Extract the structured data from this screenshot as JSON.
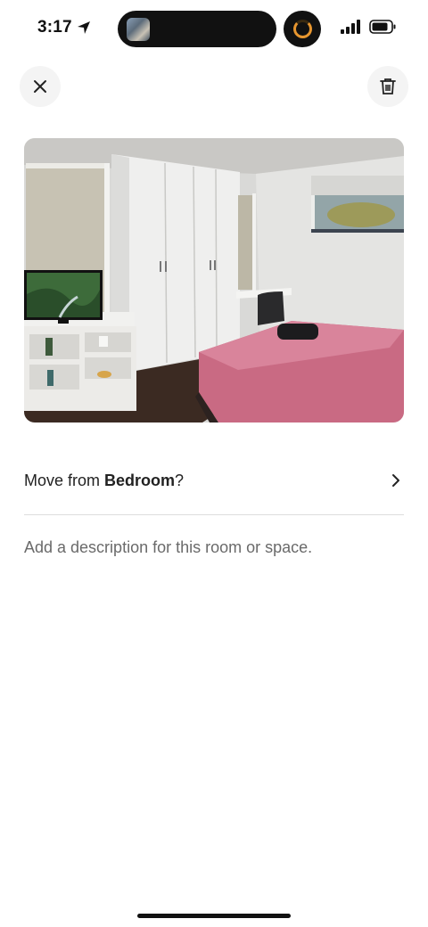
{
  "status_bar": {
    "time": "3:17",
    "location_icon": "location-arrow-icon",
    "signal_icon": "cellular-signal-icon",
    "battery_icon": "battery-icon"
  },
  "header": {
    "close_icon": "close-icon",
    "delete_icon": "trash-icon"
  },
  "photo": {
    "alt": "Bedroom photo"
  },
  "move_row": {
    "prefix": "Move from ",
    "room": "Bedroom",
    "suffix": "?"
  },
  "description": {
    "placeholder": "Add a description for this room or space."
  },
  "colors": {
    "text": "#222222",
    "muted": "#6a6a6a",
    "divider": "#dddddd",
    "button_bg": "#f4f4f4"
  }
}
